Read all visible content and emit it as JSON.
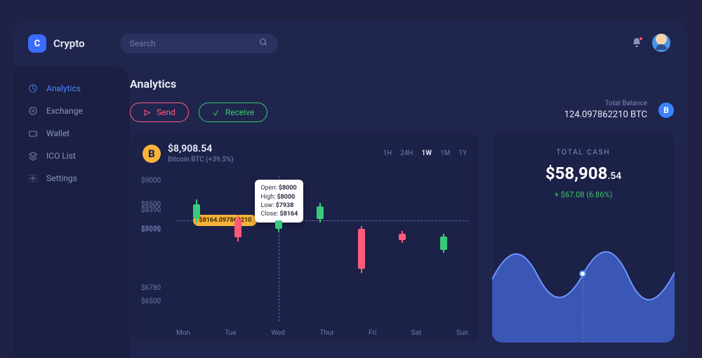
{
  "brand": {
    "letter": "C",
    "name": "Crypto"
  },
  "search": {
    "placeholder": "Search"
  },
  "sidebar": {
    "items": [
      {
        "label": "Analytics",
        "active": true
      },
      {
        "label": "Exchange"
      },
      {
        "label": "Wallet"
      },
      {
        "label": "ICO List"
      },
      {
        "label": "Settings"
      }
    ]
  },
  "page": {
    "title": "Analytics"
  },
  "actions": {
    "send": "Send",
    "receive": "Receive"
  },
  "balance": {
    "label": "Total Balance",
    "value": "124.097862210 BTC",
    "badge_letter": "B"
  },
  "chart": {
    "price": "$8,908.54",
    "subtitle": "Bitcoin BTC (+39.5%)",
    "badge_letter": "B",
    "ranges": [
      "1H",
      "24H",
      "1W",
      "1M",
      "1Y"
    ],
    "ranges_selected": "1W",
    "price_pill": "$8164.097862210",
    "tooltip": {
      "open": "$8000",
      "high": "$8000",
      "low": "$7938",
      "close": "$8164"
    }
  },
  "totalcash": {
    "title": "TOTAL CASH",
    "value_main": "$58,908",
    "value_cents": ".54",
    "delta": "+ $67.08 (6.86%)"
  },
  "chart_data": {
    "type": "candlestick",
    "title": "Bitcoin BTC",
    "y_ticks": [
      9000,
      8500,
      8390,
      8000,
      7976,
      6780,
      6500
    ],
    "ylim": [
      6400,
      9100
    ],
    "categories": [
      "Mon",
      "Tue",
      "Wed",
      "Thur",
      "Fri",
      "Sat",
      "Sun"
    ],
    "crosshair": {
      "x": "Wed",
      "y": 8164.09786221
    },
    "series": [
      {
        "x": "Mon",
        "open": 8220,
        "high": 8600,
        "low": 8120,
        "close": 8500,
        "color": "green"
      },
      {
        "x": "Tue",
        "open": 8200,
        "high": 8280,
        "low": 7740,
        "close": 7820,
        "color": "red"
      },
      {
        "x": "Wed",
        "open": 8000,
        "high": 8000,
        "low": 7938,
        "close": 8164,
        "color": "green"
      },
      {
        "x": "Thur",
        "open": 8200,
        "high": 8540,
        "low": 8120,
        "close": 8460,
        "color": "green"
      },
      {
        "x": "Fri",
        "open": 8000,
        "high": 8050,
        "low": 7080,
        "close": 7170,
        "color": "red"
      },
      {
        "x": "Sat",
        "open": 7900,
        "high": 7960,
        "low": 7700,
        "close": 7760,
        "color": "red"
      },
      {
        "x": "Sun",
        "open": 7560,
        "high": 7890,
        "low": 7500,
        "close": 7840,
        "color": "green"
      }
    ]
  }
}
